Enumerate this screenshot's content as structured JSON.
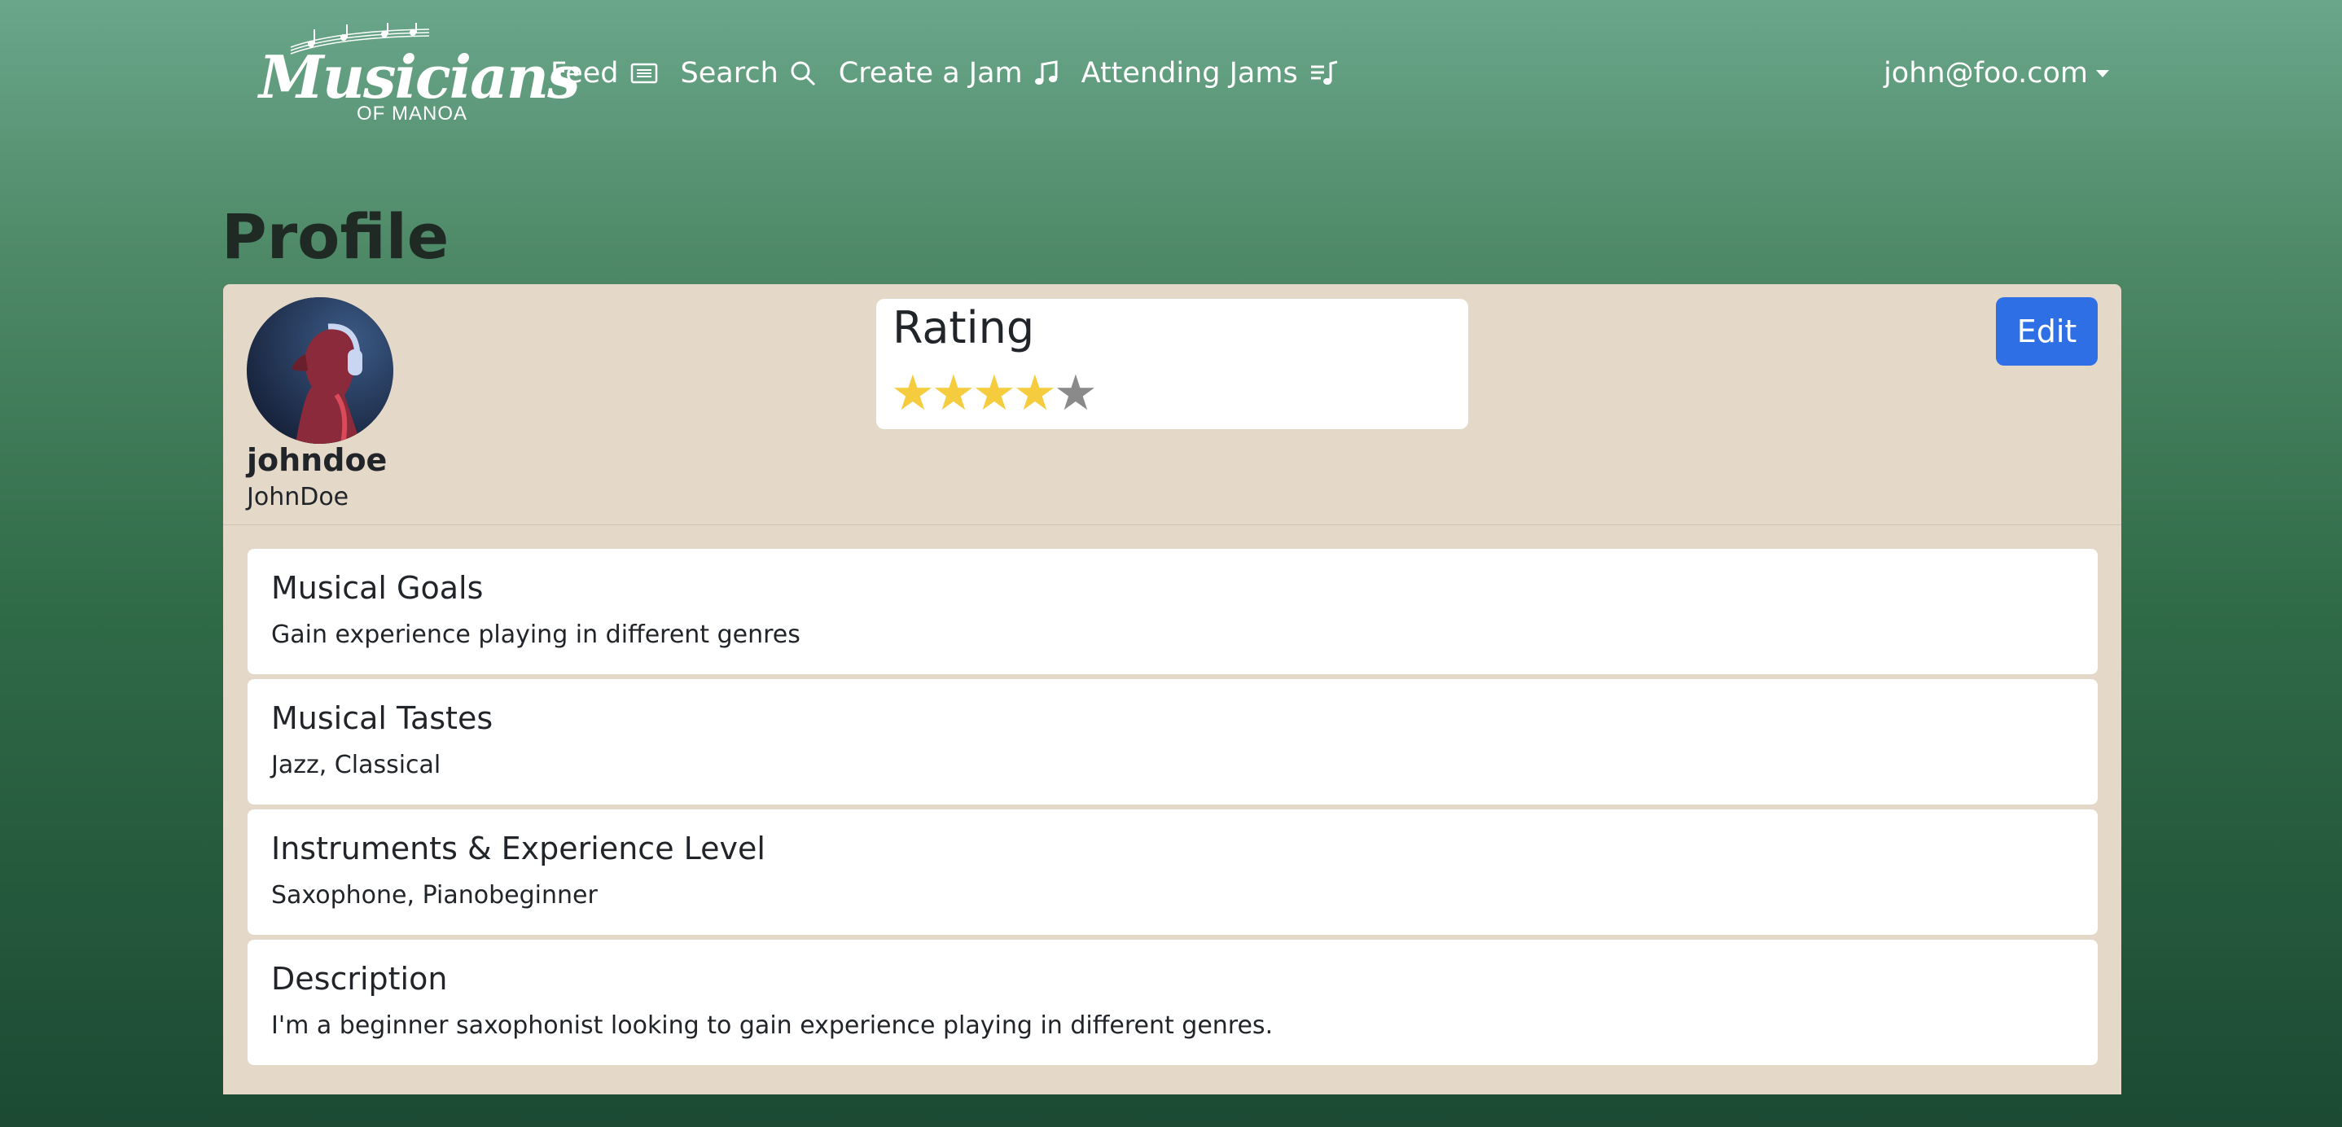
{
  "brand": {
    "name": "Musicians",
    "sub": "OF MANOA"
  },
  "nav": {
    "links": [
      {
        "label": "Feed",
        "icon": "newspaper-icon"
      },
      {
        "label": "Search",
        "icon": "search-icon"
      },
      {
        "label": "Create a Jam",
        "icon": "music-note-icon"
      },
      {
        "label": "Attending Jams",
        "icon": "music-list-icon"
      }
    ],
    "user": "john@foo.com"
  },
  "page": {
    "title": "Profile"
  },
  "profile": {
    "username": "johndoe",
    "display_name": "JohnDoe",
    "avatar": "headphones-portrait",
    "rating": {
      "title": "Rating",
      "value": 4,
      "max": 5
    },
    "edit_label": "Edit",
    "sections": [
      {
        "title": "Musical Goals",
        "text": "Gain experience playing in different genres"
      },
      {
        "title": "Musical Tastes",
        "text": "Jazz, Classical"
      },
      {
        "title": "Instruments & Experience Level",
        "text": "Saxophone, Pianobeginner"
      },
      {
        "title": "Description",
        "text": "I'm a beginner saxophonist looking to gain experience playing in different genres."
      }
    ]
  },
  "colors": {
    "accent": "#2f6fe6",
    "star_on": "#f5cc3d",
    "star_off": "#8a8a8a",
    "card_bg": "#e4d9c8"
  }
}
